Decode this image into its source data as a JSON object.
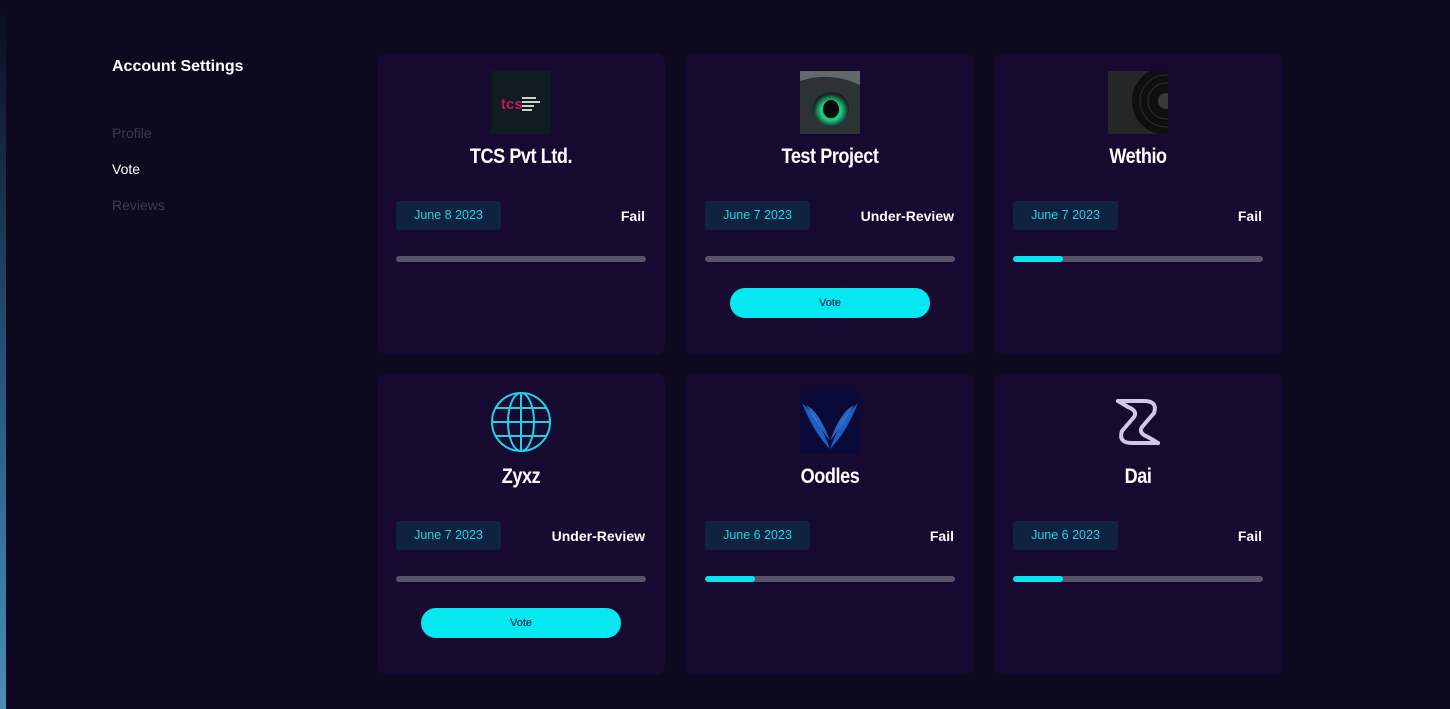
{
  "sidebar": {
    "title": "Account Settings",
    "items": [
      {
        "label": "Profile",
        "active": false
      },
      {
        "label": "Vote",
        "active": true
      },
      {
        "label": "Reviews",
        "active": false
      }
    ]
  },
  "colors": {
    "accent": "#00e5f0",
    "card_bg": "#160a31",
    "page_bg": "#0d0a1f"
  },
  "cards": [
    {
      "name": "TCS Pvt Ltd.",
      "logo_icon": "tcs-logo",
      "logo_text": "tcs",
      "date": "June 8 2023",
      "status": "Fail",
      "progress": 0,
      "vote_label": ""
    },
    {
      "name": "Test Project",
      "logo_icon": "green-eye-image",
      "date": "June 7 2023",
      "status": "Under-Review",
      "progress": 0,
      "vote_label": "Vote"
    },
    {
      "name": "Wethio",
      "logo_icon": "vinyl-record-image",
      "date": "June 7 2023",
      "status": "Fail",
      "progress": 0.2,
      "vote_label": ""
    },
    {
      "name": "Zyxz",
      "logo_icon": "globe-icon",
      "date": "June 7 2023",
      "status": "Under-Review",
      "progress": 0,
      "vote_label": "Vote"
    },
    {
      "name": "Oodles",
      "logo_icon": "wings-logo",
      "date": "June 6 2023",
      "status": "Fail",
      "progress": 0.2,
      "vote_label": ""
    },
    {
      "name": "Dai",
      "logo_icon": "dai-logo",
      "date": "June 6 2023",
      "status": "Fail",
      "progress": 0.2,
      "vote_label": ""
    }
  ]
}
